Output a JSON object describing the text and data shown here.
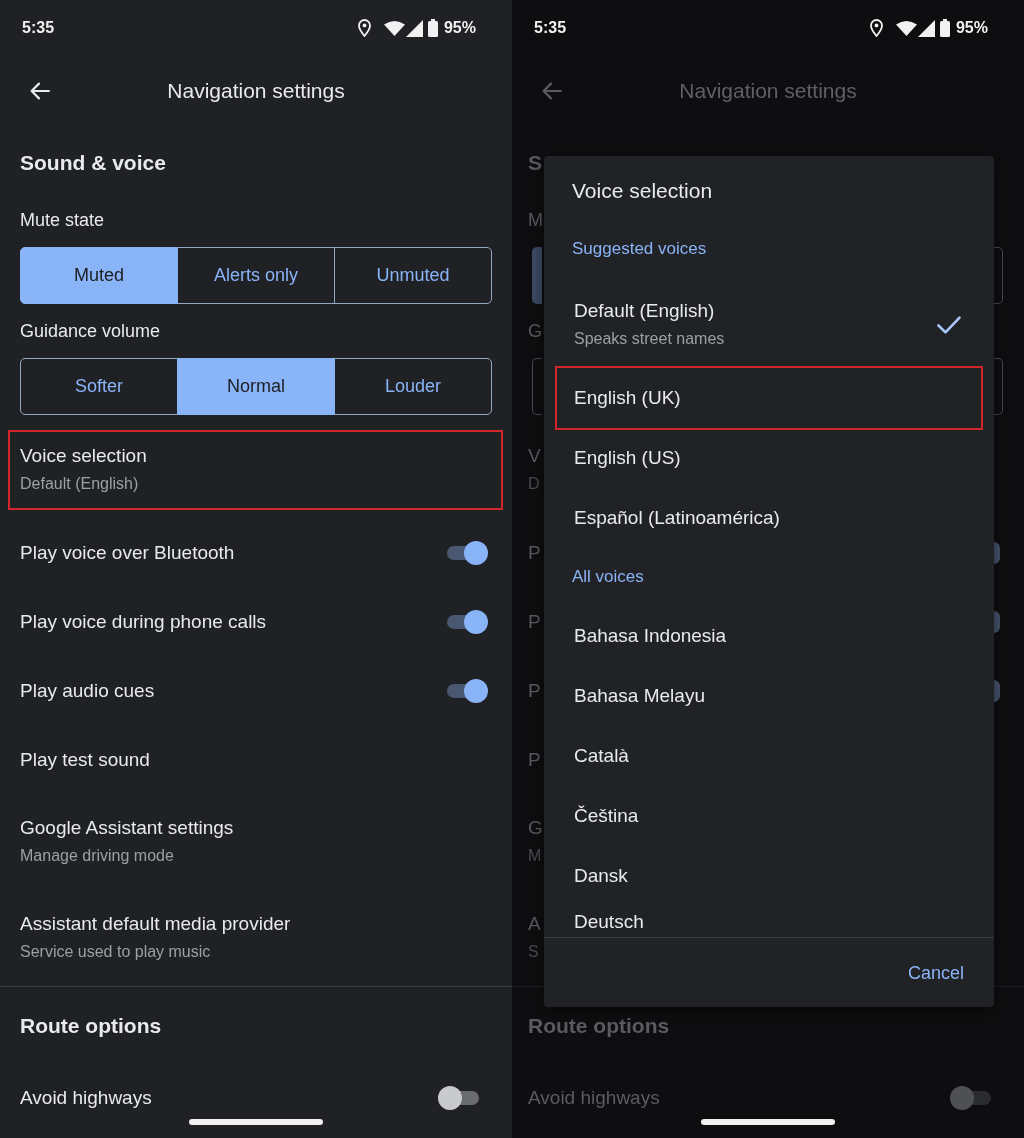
{
  "left_screen": {
    "status_bar": {
      "time": "5:35",
      "battery": "95%"
    },
    "app_bar": {
      "title": "Navigation settings"
    },
    "items": [
      {
        "kind": "heading",
        "title": "Sound & voice"
      },
      {
        "kind": "label",
        "title": "Mute state"
      },
      {
        "kind": "segmented",
        "options": [
          {
            "label": "Muted",
            "selected": true
          },
          {
            "label": "Alerts only",
            "selected": false
          },
          {
            "label": "Unmuted",
            "selected": false
          }
        ]
      },
      {
        "kind": "label",
        "title": "Guidance volume"
      },
      {
        "kind": "segmented",
        "options": [
          {
            "label": "Softer",
            "selected": false
          },
          {
            "label": "Normal",
            "selected": true
          },
          {
            "label": "Louder",
            "selected": false
          }
        ]
      },
      {
        "kind": "item",
        "title": "Voice selection",
        "subtitle": "Default (English)",
        "highlighted": true
      },
      {
        "kind": "switch",
        "title": "Play voice over Bluetooth",
        "on": true
      },
      {
        "kind": "switch",
        "title": "Play voice during phone calls",
        "on": true
      },
      {
        "kind": "switch",
        "title": "Play audio cues",
        "on": true
      },
      {
        "kind": "item",
        "title": "Play test sound",
        "highlighted": false
      },
      {
        "kind": "item",
        "title": "Google Assistant settings",
        "subtitle": "Manage driving mode",
        "highlighted": false
      },
      {
        "kind": "item",
        "title": "Assistant default media provider",
        "subtitle": "Service used to play music",
        "highlighted": false
      },
      {
        "kind": "heading",
        "title": "Route options"
      },
      {
        "kind": "switch",
        "title": "Avoid highways",
        "on": false
      }
    ]
  },
  "right_screen": {
    "status_bar": {
      "time": "5:35",
      "battery": "95%"
    },
    "app_bar": {
      "title": "Navigation settings"
    },
    "background_items": [
      {
        "kind": "heading",
        "title": "S"
      },
      {
        "kind": "label",
        "title": "M"
      },
      {
        "kind": "segmented_edges",
        "first_selected": true,
        "last_selected": false
      },
      {
        "kind": "label",
        "title": "G"
      },
      {
        "kind": "segmented_edges",
        "first_selected": false,
        "last_selected": false
      },
      {
        "kind": "item",
        "title": "V",
        "subtitle": "D"
      },
      {
        "kind": "switch_edge",
        "title": "P",
        "on": true
      },
      {
        "kind": "switch_edge",
        "title": "P",
        "on": true
      },
      {
        "kind": "switch_edge",
        "title": "P",
        "on": true
      },
      {
        "kind": "item",
        "title": "P"
      },
      {
        "kind": "item",
        "title": "G",
        "subtitle": "M"
      },
      {
        "kind": "item",
        "title": "A",
        "subtitle": "S"
      },
      {
        "kind": "heading",
        "title": "Route options"
      },
      {
        "kind": "switch",
        "title": "Avoid highways",
        "on": false
      }
    ],
    "dialog": {
      "title": "Voice selection",
      "sections": [
        {
          "header": "Suggested voices",
          "options": [
            {
              "label": "Default (English)",
              "subtitle": "Speaks street names",
              "selected": true,
              "highlighted": false
            },
            {
              "label": "English (UK)",
              "selected": false,
              "highlighted": true
            },
            {
              "label": "English (US)",
              "selected": false,
              "highlighted": false
            },
            {
              "label": "Español (Latinoamérica)",
              "selected": false,
              "highlighted": false
            }
          ]
        },
        {
          "header": "All voices",
          "options": [
            {
              "label": "Bahasa Indonesia",
              "selected": false,
              "highlighted": false
            },
            {
              "label": "Bahasa Melayu",
              "selected": false,
              "highlighted": false
            },
            {
              "label": "Català",
              "selected": false,
              "highlighted": false
            },
            {
              "label": "Čeština",
              "selected": false,
              "highlighted": false
            },
            {
              "label": "Dansk",
              "selected": false,
              "highlighted": false
            },
            {
              "label": "Deutsch",
              "selected": false,
              "highlighted": false
            }
          ]
        }
      ],
      "cancel": {
        "label": "Cancel"
      }
    }
  }
}
